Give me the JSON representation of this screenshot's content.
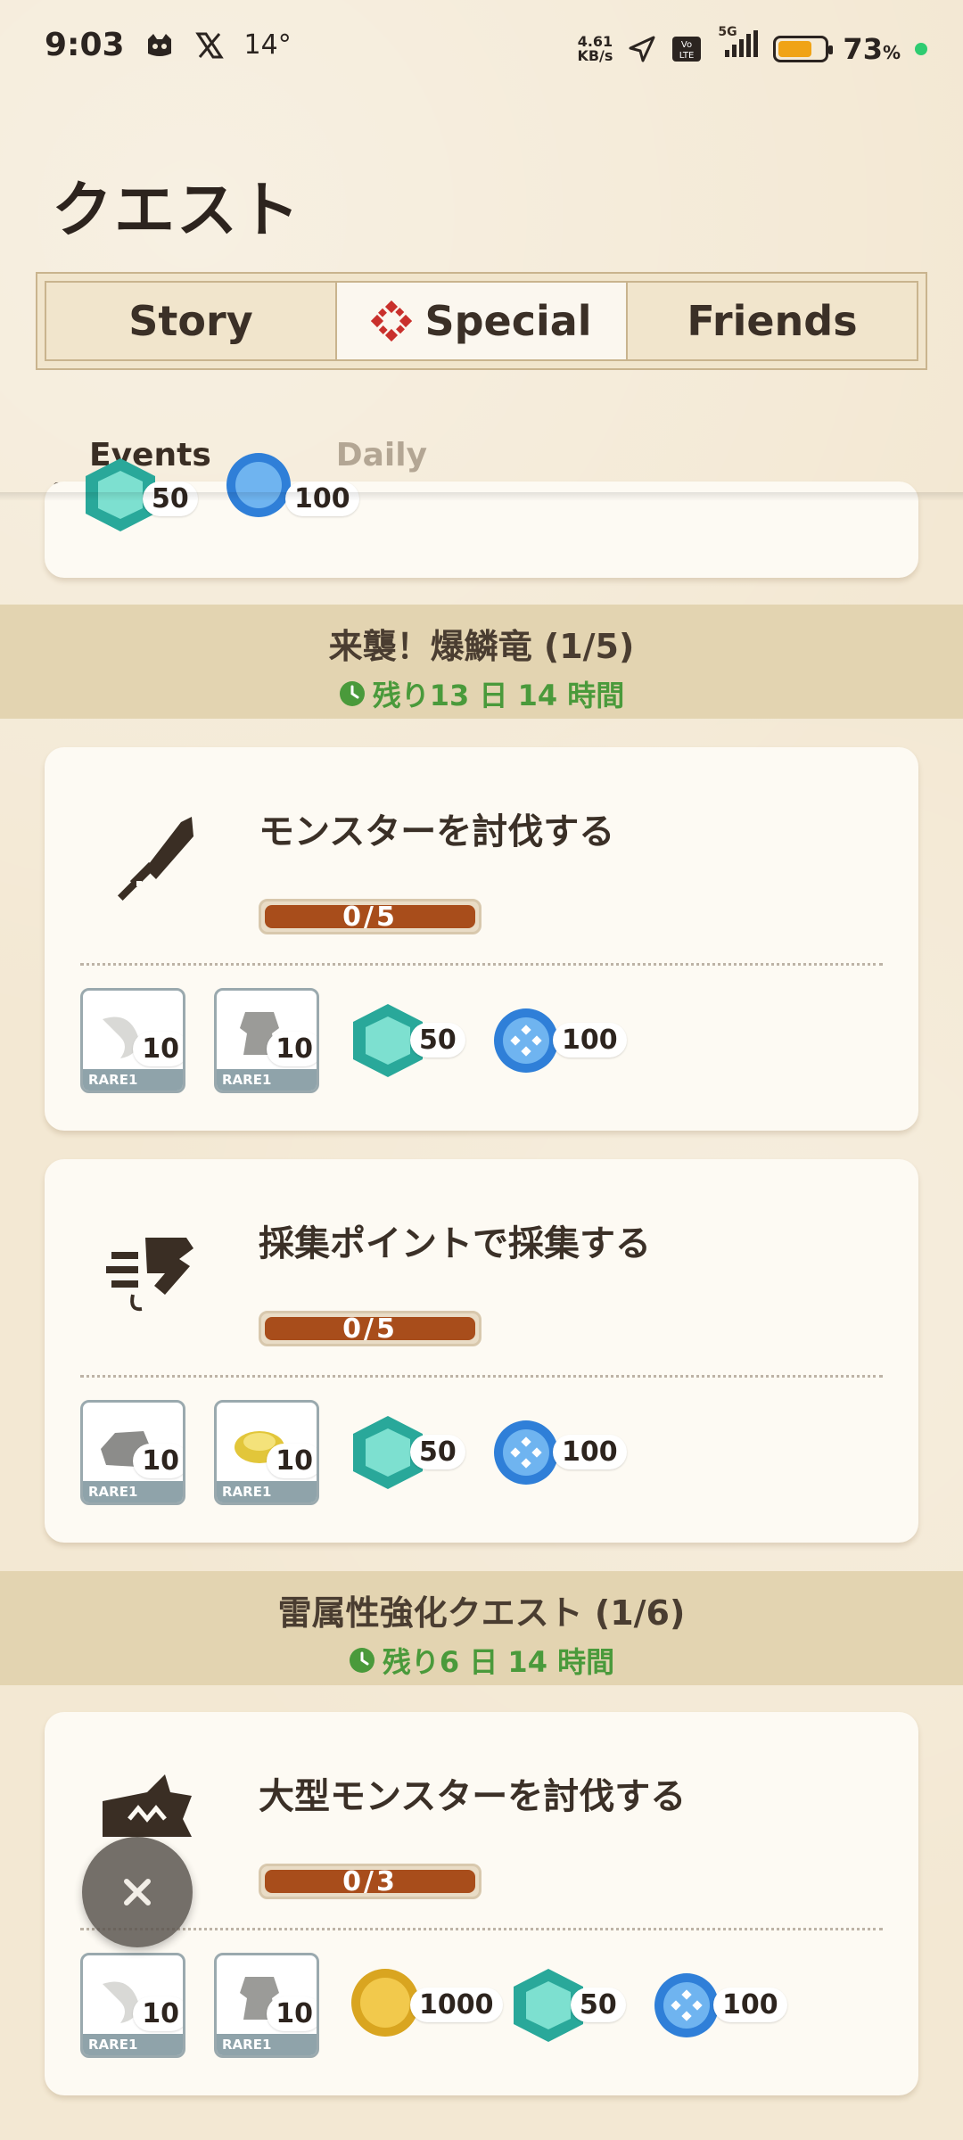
{
  "status_bar": {
    "time": "9:03",
    "temperature": "14°",
    "net_speed_top": "4.61",
    "net_speed_unit": "KB/s",
    "network": "5G",
    "battery_pct": "73",
    "battery_suffix": "%",
    "battery_level": 0.73
  },
  "page_title": "クエスト",
  "tabs": [
    {
      "label": "Story",
      "active": false
    },
    {
      "label": "Special",
      "active": true
    },
    {
      "label": "Friends",
      "active": false
    }
  ],
  "subtabs": [
    {
      "label": "Events",
      "active": true
    },
    {
      "label": "Daily",
      "active": false
    }
  ],
  "top_card_partial": {
    "gem_qty": "50",
    "orb_qty": "100"
  },
  "sections": [
    {
      "title": "来襲！爆鱗竜 (1/5)",
      "time_left": "残り13 日 14 時間",
      "quests": [
        {
          "title": "モンスターを討伐する",
          "progress": "0/5",
          "progress_value": 0,
          "rewards": {
            "item1_qty": "10",
            "item1_rare": "RARE1",
            "item2_qty": "10",
            "item2_rare": "RARE1",
            "gem_qty": "50",
            "orb_qty": "100"
          }
        },
        {
          "title": "採集ポイントで採集する",
          "progress": "0/5",
          "progress_value": 0,
          "rewards": {
            "item1_qty": "10",
            "item1_rare": "RARE1",
            "item2_qty": "10",
            "item2_rare": "RARE1",
            "gem_qty": "50",
            "orb_qty": "100"
          }
        }
      ]
    },
    {
      "title": "雷属性強化クエスト (1/6)",
      "time_left": "残り6 日 14 時間",
      "quests": [
        {
          "title": "大型モンスターを討伐する",
          "progress": "0/3",
          "progress_value": 0,
          "rewards": {
            "item1_qty": "10",
            "item1_rare": "RARE1",
            "item2_qty": "10",
            "item2_rare": "RARE1",
            "coin_qty": "1000",
            "gem_qty": "50",
            "orb_qty": "100"
          }
        }
      ]
    }
  ],
  "colors": {
    "accent_brown": "#a84d1b",
    "time_green": "#4a9a3b",
    "section_bg": "#e3d4b1"
  },
  "icons": [
    "cat-icon",
    "x-logo-icon",
    "location-arrow-icon",
    "volte-icon",
    "signal-icon",
    "battery-icon",
    "sword-icon",
    "gather-icon",
    "monster-icon",
    "clock-icon",
    "gem-icon",
    "orb-icon",
    "coin-icon",
    "close-icon"
  ]
}
